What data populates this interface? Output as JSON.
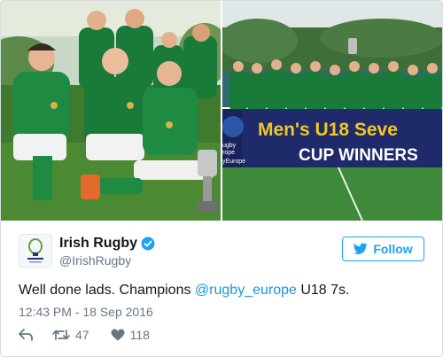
{
  "photos": [
    {
      "name": "team-celebration-photo"
    },
    {
      "name": "team-banner-photo"
    }
  ],
  "banner": {
    "line1": "Men's U18 Seve",
    "line2": "CUP WINNERS",
    "logo_line1": "ugby",
    "logo_line2": "rope",
    "logo_line3": "yEurope"
  },
  "author": {
    "display_name": "Irish Rugby",
    "handle": "@IrishRugby",
    "verified": true
  },
  "follow_label": "Follow",
  "tweet": {
    "text_before": "Well done lads. Champions ",
    "mention": "@rugby_europe",
    "text_after": " U18 7s."
  },
  "timestamp": "12:43 PM - 18 Sep 2016",
  "actions": {
    "retweets": "47",
    "likes": "118"
  },
  "colors": {
    "brand": "#1da1f2",
    "link": "#1b95e0",
    "jersey": "#1a7a3a"
  }
}
